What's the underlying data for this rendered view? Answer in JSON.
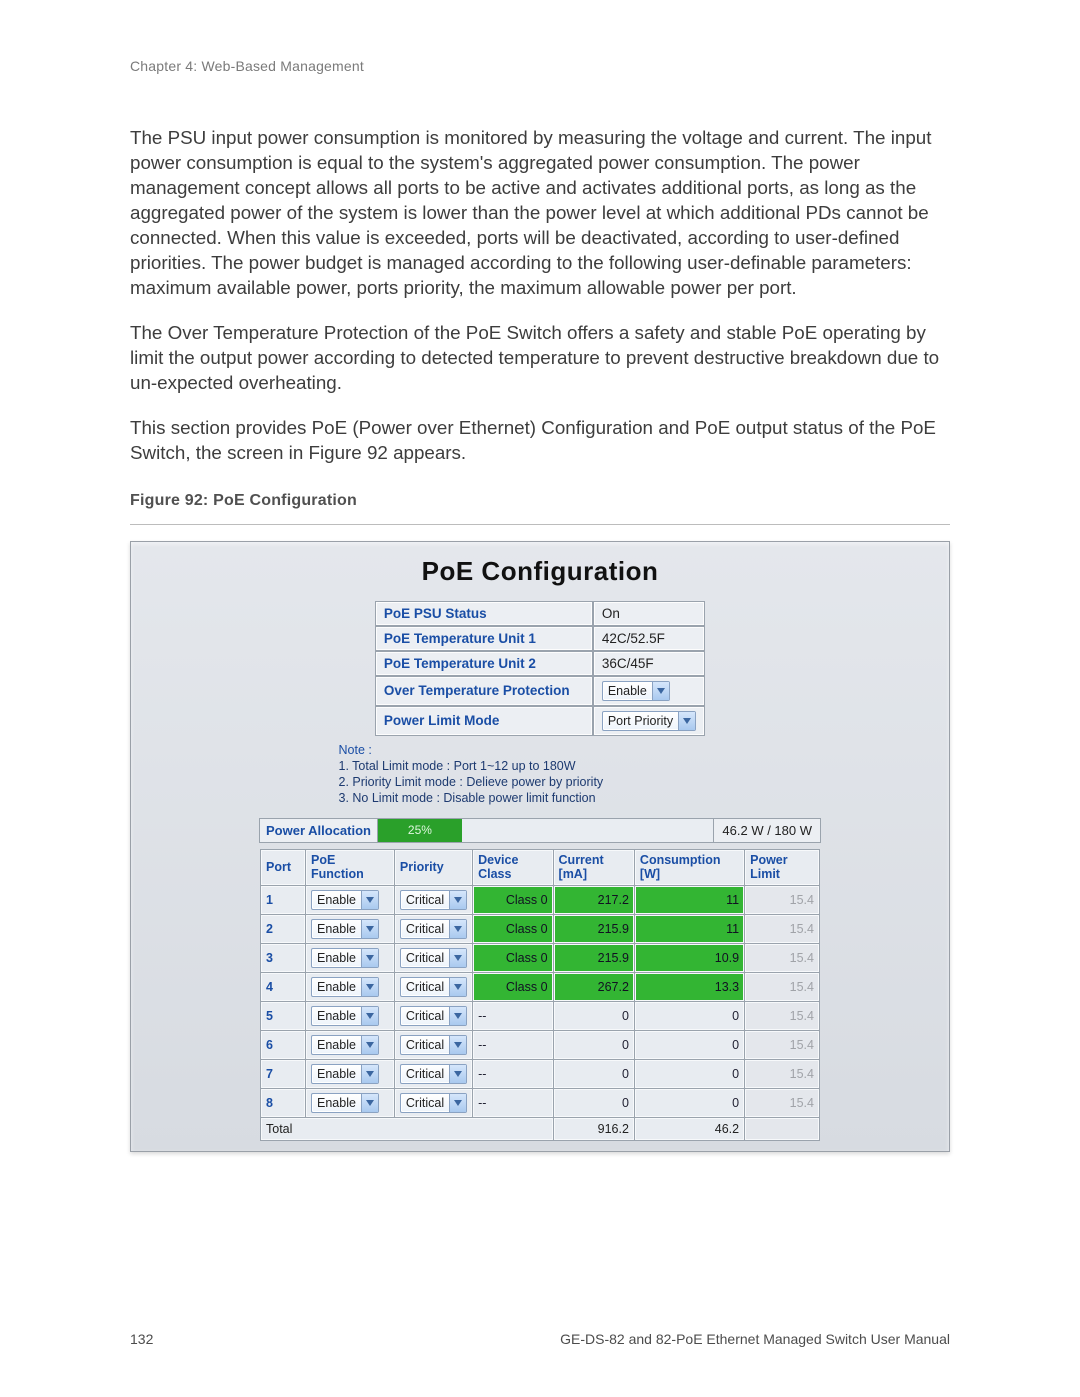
{
  "header": "Chapter 4: Web-Based Management",
  "para1": "The PSU input power consumption is monitored by measuring the voltage and current. The input power consumption is equal to the system's aggregated power consumption. The power management concept allows all ports to be active and activates additional ports, as long as the aggregated power of the system is lower than the power level at which additional PDs cannot be connected. When this value is exceeded, ports will be deactivated, according to user-defined priorities. The power budget is managed according to the following user-definable parameters: maximum available power, ports priority, the maximum allowable power per port.",
  "para2": "The Over Temperature Protection of the PoE Switch offers a safety and stable PoE operating by limit the output power according to detected temperature to prevent destructive breakdown due to un-expected overheating.",
  "para3": "This section provides PoE (Power over Ethernet) Configuration and PoE output status of the PoE Switch, the screen in Figure 92 appears.",
  "figCaption": "Figure 92: PoE Configuration",
  "shot": {
    "title": "PoE Configuration",
    "summary": {
      "psu_l": "PoE PSU Status",
      "psu_v": "On",
      "t1_l": "PoE Temperature Unit 1",
      "t1_v": "42C/52.5F",
      "t2_l": "PoE Temperature Unit 2",
      "t2_v": "36C/45F",
      "ot_l": "Over Temperature Protection",
      "ot_v": "Enable",
      "plm_l": "Power Limit Mode",
      "plm_v": "Port Priority"
    },
    "note_t": "Note :",
    "note1": "1. Total Limit mode : Port 1~12 up to 180W",
    "note2": "2. Priority Limit mode : Delieve power by priority",
    "note3": "3. No Limit mode : Disable power limit function",
    "alloc": {
      "label": "Power Allocation",
      "pct_text": "25%",
      "pct": 25,
      "ratio": "46.2 W / 180 W"
    },
    "cols": {
      "port": "Port",
      "func": "PoE Function",
      "prio": "Priority",
      "devc": "Device Class",
      "curr": "Current [mA]",
      "cons": "Consumption [W]",
      "plim": "Power Limit"
    },
    "rows": [
      {
        "port": "1",
        "func": "Enable",
        "prio": "Critical",
        "devc": "Class 0",
        "curr": "217.2",
        "cons": "11",
        "plim": "15.4",
        "active": true
      },
      {
        "port": "2",
        "func": "Enable",
        "prio": "Critical",
        "devc": "Class 0",
        "curr": "215.9",
        "cons": "11",
        "plim": "15.4",
        "active": true
      },
      {
        "port": "3",
        "func": "Enable",
        "prio": "Critical",
        "devc": "Class 0",
        "curr": "215.9",
        "cons": "10.9",
        "plim": "15.4",
        "active": true
      },
      {
        "port": "4",
        "func": "Enable",
        "prio": "Critical",
        "devc": "Class 0",
        "curr": "267.2",
        "cons": "13.3",
        "plim": "15.4",
        "active": true
      },
      {
        "port": "5",
        "func": "Enable",
        "prio": "Critical",
        "devc": "--",
        "curr": "0",
        "cons": "0",
        "plim": "15.4",
        "active": false
      },
      {
        "port": "6",
        "func": "Enable",
        "prio": "Critical",
        "devc": "--",
        "curr": "0",
        "cons": "0",
        "plim": "15.4",
        "active": false
      },
      {
        "port": "7",
        "func": "Enable",
        "prio": "Critical",
        "devc": "--",
        "curr": "0",
        "cons": "0",
        "plim": "15.4",
        "active": false
      },
      {
        "port": "8",
        "func": "Enable",
        "prio": "Critical",
        "devc": "--",
        "curr": "0",
        "cons": "0",
        "plim": "15.4",
        "active": false
      }
    ],
    "total": {
      "label": "Total",
      "curr": "916.2",
      "cons": "46.2"
    }
  },
  "footer": {
    "page": "132",
    "doc": "GE-DS-82 and 82-PoE Ethernet Managed Switch User Manual"
  }
}
